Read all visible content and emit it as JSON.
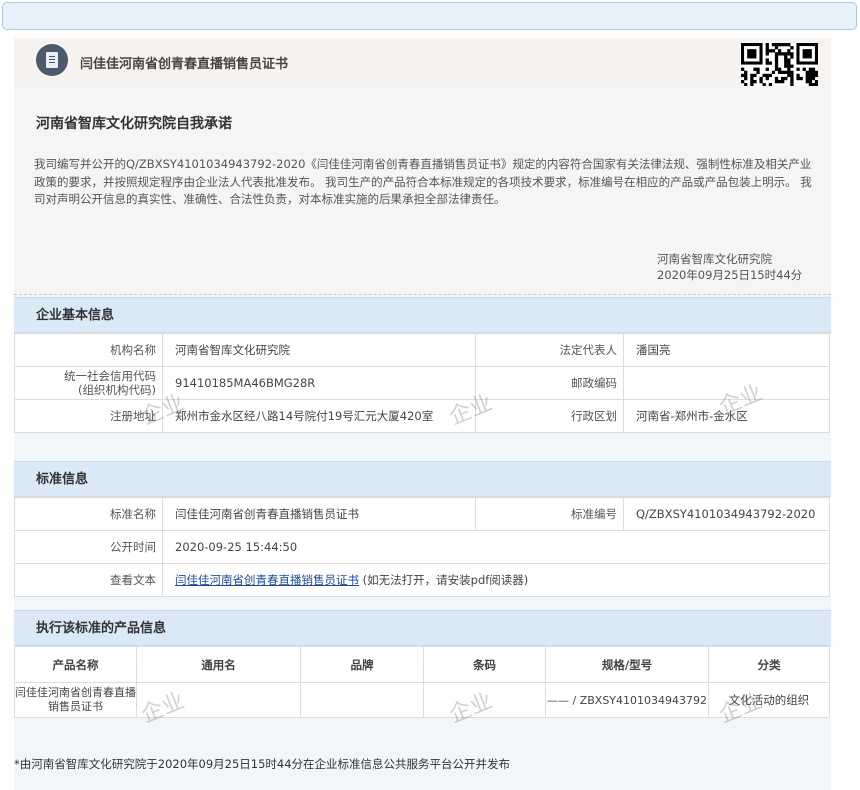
{
  "header": {
    "title": "闫佳佳河南省创青春直播销售员证书"
  },
  "promise": {
    "title": "河南省智库文化研究院自我承诺",
    "text": "我司编写并公开的Q/ZBXSY4101034943792-2020《闫佳佳河南省创青春直播销售员证书》规定的内容符合国家有关法律法规、强制性标准及相关产业政策的要求，并按照规定程序由企业法人代表批准发布。 我司生产的产品符合本标准规定的各项技术要求，标准编号在相应的产品或产品包装上明示。 我司对声明公开信息的真实性、准确性、合法性负责，对本标准实施的后果承担全部法律责任。",
    "sign_org": "河南省智库文化研究院",
    "sign_time": "2020年09月25日15时44分"
  },
  "company": {
    "heading": "企业基本信息",
    "name_label": "机构名称",
    "name": "河南省智库文化研究院",
    "legal_label": "法定代表人",
    "legal": "潘国亮",
    "credit_label1": "统一社会信用代码",
    "credit_label2": "(组织机构代码)",
    "credit": "91410185MA46BMG28R",
    "postal_label": "邮政编码",
    "postal": "",
    "address_label": "注册地址",
    "address": "郑州市金水区经八路14号院付19号汇元大厦420室",
    "region_label": "行政区划",
    "region": "河南省-郑州市-金水区"
  },
  "standard": {
    "heading": "标准信息",
    "name_label": "标准名称",
    "name": "闫佳佳河南省创青春直播销售员证书",
    "code_label": "标准编号",
    "code": "Q/ZBXSY4101034943792-2020",
    "time_label": "公开时间",
    "time": "2020-09-25 15:44:50",
    "text_label": "查看文本",
    "text_link": "闫佳佳河南省创青春直播销售员证书",
    "text_hint": " (如无法打开，请安装pdf阅读器)"
  },
  "products": {
    "heading": "执行该标准的产品信息",
    "columns": [
      "产品名称",
      "通用名",
      "品牌",
      "条码",
      "规格/型号",
      "分类"
    ],
    "rows": [
      [
        "闫佳佳河南省创青春直播销售员证书",
        "",
        "",
        "",
        "—— / ZBXSY4101034943792",
        "文化活动的组织"
      ]
    ]
  },
  "footer_note": "*由河南省智库文化研究院于2020年09月25日15时44分在企业标准信息公共服务平台公开并发布",
  "watermark_text": "企业",
  "colors": {
    "section_header": "#dbe9f6",
    "link": "#1a4a9a",
    "header_icon": "#4a5a6c"
  }
}
